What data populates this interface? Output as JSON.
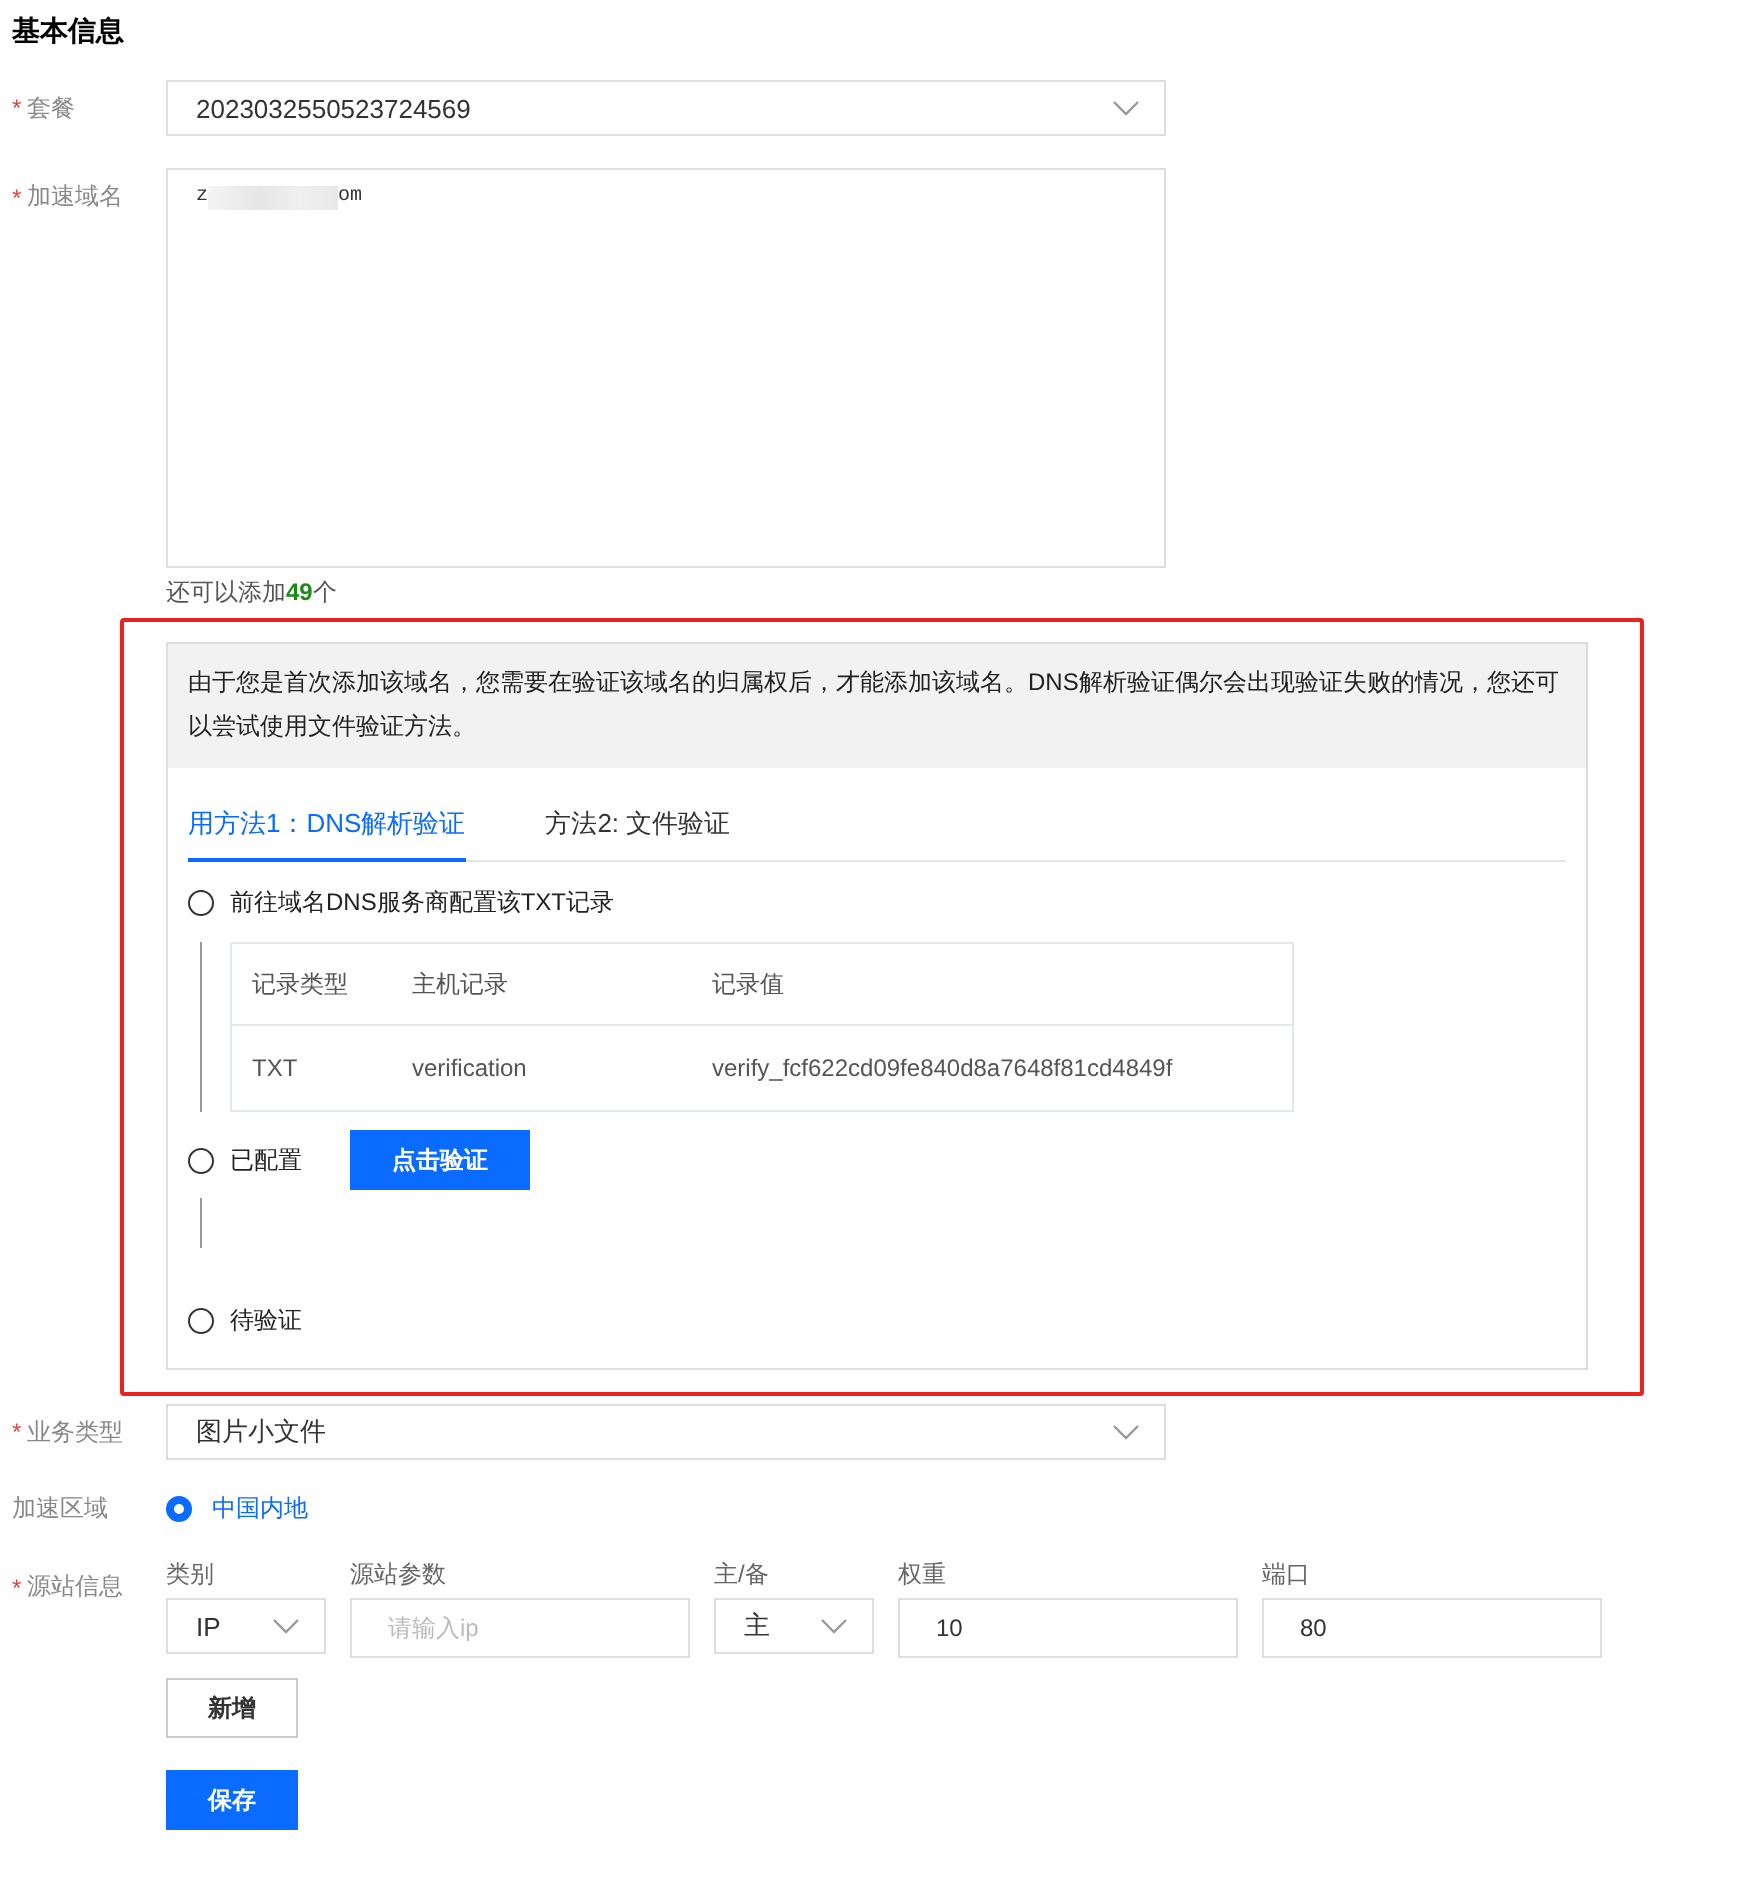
{
  "section_title": "基本信息",
  "package": {
    "label": "套餐",
    "required_mark": "*",
    "value": "2023032550523724569"
  },
  "domain": {
    "label": "加速域名",
    "required_mark": "*",
    "value_start": "z",
    "value_end": "om",
    "hint": "还可以添加**49**个"
  },
  "verification": {
    "notice": "由于您是首次添加该域名，您需要在验证该域名的归属权后，才能添加该域名。DNS解析验证偶尔会出现验证失败的情况，您还可以尝试使用文件验证方法。",
    "tabs": [
      {
        "label": "用方法1：DNS解析验证",
        "selected": true
      },
      {
        "label": "方法2: 文件验证",
        "selected": false
      }
    ],
    "steps": [
      {
        "kind": "table",
        "label": "前往域名DNS服务商配置该TXT记录",
        "checked": false,
        "columns": [
          "记录类型",
          "主机记录",
          "记录值"
        ],
        "rows": [
          [
            "TXT",
            "verification",
            "verify_fcf622cd09fe840d8a7648f81cd4849f"
          ]
        ]
      },
      {
        "kind": "button",
        "label": "已配置",
        "checked": false,
        "button": "点击验证"
      },
      {
        "kind": "plain",
        "label": "待验证",
        "checked": false
      }
    ]
  },
  "business_type": {
    "label": "业务类型",
    "required_mark": "*",
    "value": "图片小文件"
  },
  "region": {
    "label": "加速区域",
    "options": [
      {
        "label": "中国内地",
        "selected": true
      }
    ]
  },
  "origin": {
    "label": "源站信息",
    "required_mark": "*",
    "fields": [
      {
        "kind": "select",
        "label": "类别",
        "value": "IP"
      },
      {
        "kind": "input",
        "label": "源站参数",
        "placeholder": "请输入ip"
      },
      {
        "kind": "select",
        "label": "主/备",
        "value": "主"
      },
      {
        "kind": "input",
        "label": "权重",
        "value": "10"
      },
      {
        "kind": "input",
        "label": "端口",
        "value": "80"
      }
    ],
    "add_button": "新增"
  },
  "save_button": "保存"
}
